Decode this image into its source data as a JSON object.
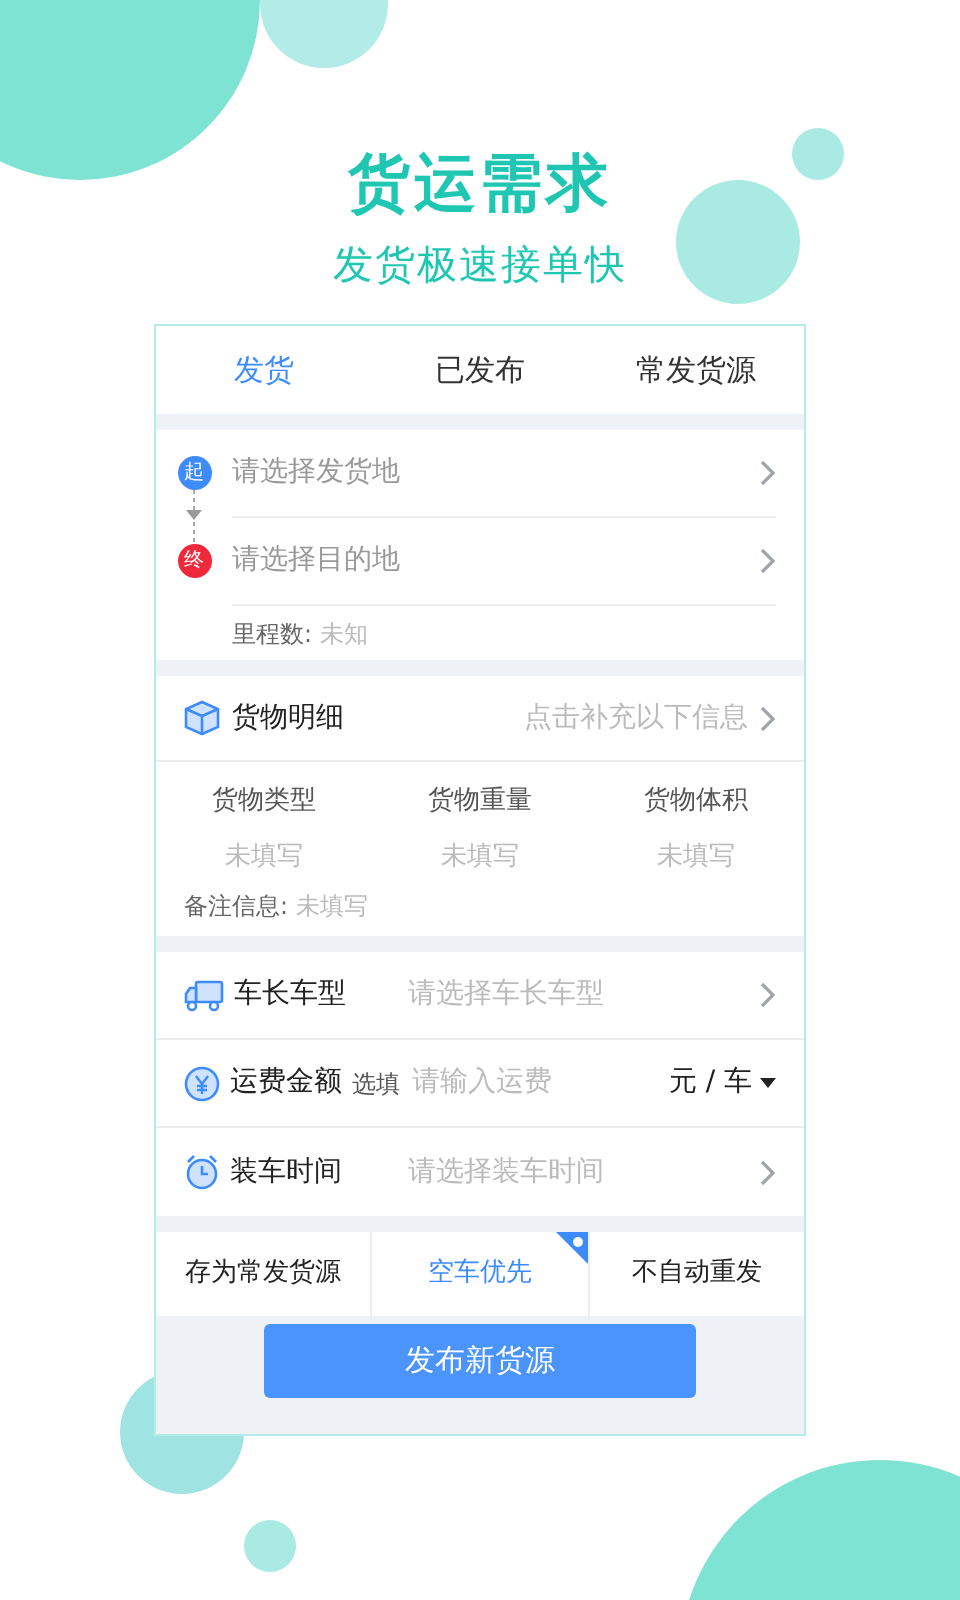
{
  "headline": "货运需求",
  "subtitle": "发货极速接单快",
  "tabs": [
    {
      "label": "发货",
      "selected": true
    },
    {
      "label": "已发布",
      "selected": false
    },
    {
      "label": "常发货源",
      "selected": false
    }
  ],
  "route": {
    "origin": {
      "badge": "起",
      "placeholder": "请选择发货地"
    },
    "destination": {
      "badge": "终",
      "placeholder": "请选择目的地"
    },
    "distance_label": "里程数:",
    "distance_value": "未知"
  },
  "goods": {
    "title": "货物明细",
    "hint": "点击补充以下信息",
    "columns": [
      {
        "label": "货物类型",
        "value": "未填写"
      },
      {
        "label": "货物重量",
        "value": "未填写"
      },
      {
        "label": "货物体积",
        "value": "未填写"
      }
    ],
    "note_label": "备注信息:",
    "note_value": "未填写"
  },
  "fields": [
    {
      "kind": "select",
      "label": "车长车型",
      "placeholder": "请选择车长车型"
    },
    {
      "kind": "input",
      "label": "运费金额",
      "optional": "选填",
      "placeholder": "请输入运费",
      "unit": "元 / 车"
    },
    {
      "kind": "select",
      "label": "装车时间",
      "placeholder": "请选择装车时间"
    }
  ],
  "options": [
    {
      "label": "存为常发货源",
      "selected": false
    },
    {
      "label": "空车优先",
      "selected": true
    },
    {
      "label": "不自动重发",
      "selected": false
    }
  ],
  "submit": "发布新货源"
}
